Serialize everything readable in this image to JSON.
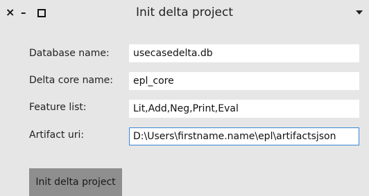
{
  "window": {
    "title": "Init delta project",
    "close_glyph": "×",
    "minimize_glyph": "–",
    "icons": [
      "close-icon",
      "minimize-icon",
      "maximize-icon",
      "chevron-down-icon"
    ]
  },
  "form": {
    "database_name": {
      "label": "Database name:",
      "value": "usecasedelta.db"
    },
    "delta_core_name": {
      "label": "Delta core name:",
      "value": "epl_core"
    },
    "feature_list": {
      "label": "Feature list:",
      "value": "Lit,Add,Neg,Print,Eval"
    },
    "artifact_uri": {
      "label": "Artifact uri:",
      "value": "D:\\Users\\firstname.name\\epl\\artifactsjson"
    }
  },
  "actions": {
    "init_label": "Init delta project"
  },
  "colors": {
    "window_bg": "#e6e6e6",
    "button_bg": "#8e8e8e",
    "focus_border": "#3a86d4"
  }
}
